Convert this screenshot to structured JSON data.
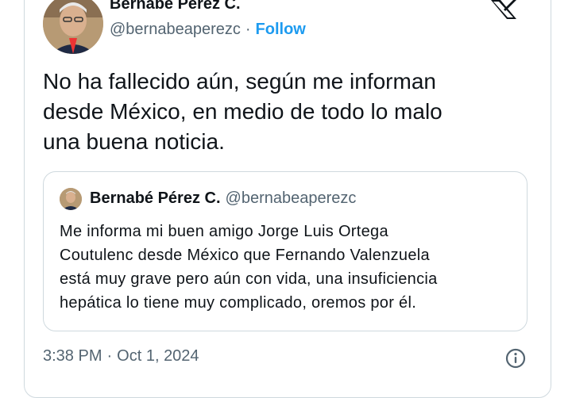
{
  "tweet": {
    "author_name": "Bernabe Pérez C.",
    "handle": "@bernabeaperezc",
    "separator": "·",
    "follow_label": "Follow",
    "text_lines": [
      "No ha fallecido aún, según me informan",
      "desde México, en medio de todo lo malo",
      "una buena noticia."
    ],
    "time": "3:38 PM",
    "date": "Oct 1, 2024"
  },
  "quoted_tweet": {
    "author_name": "Bernabé Pérez C.",
    "handle": "@bernabeaperezc",
    "text_lines": [
      "Me informa mi buen amigo Jorge Luis Ortega",
      "Coutulenc desde México que Fernando Valenzuela",
      "está muy grave pero aún con vida, una insuficiencia",
      "hepática lo tiene muy complicado, oremos por él."
    ]
  },
  "icons": {
    "brand": "x-logo-icon",
    "info": "info-icon"
  },
  "colors": {
    "text": "#0f1419",
    "secondary_text": "#536471",
    "accent": "#1d9bf0",
    "border": "#cfd9de"
  }
}
